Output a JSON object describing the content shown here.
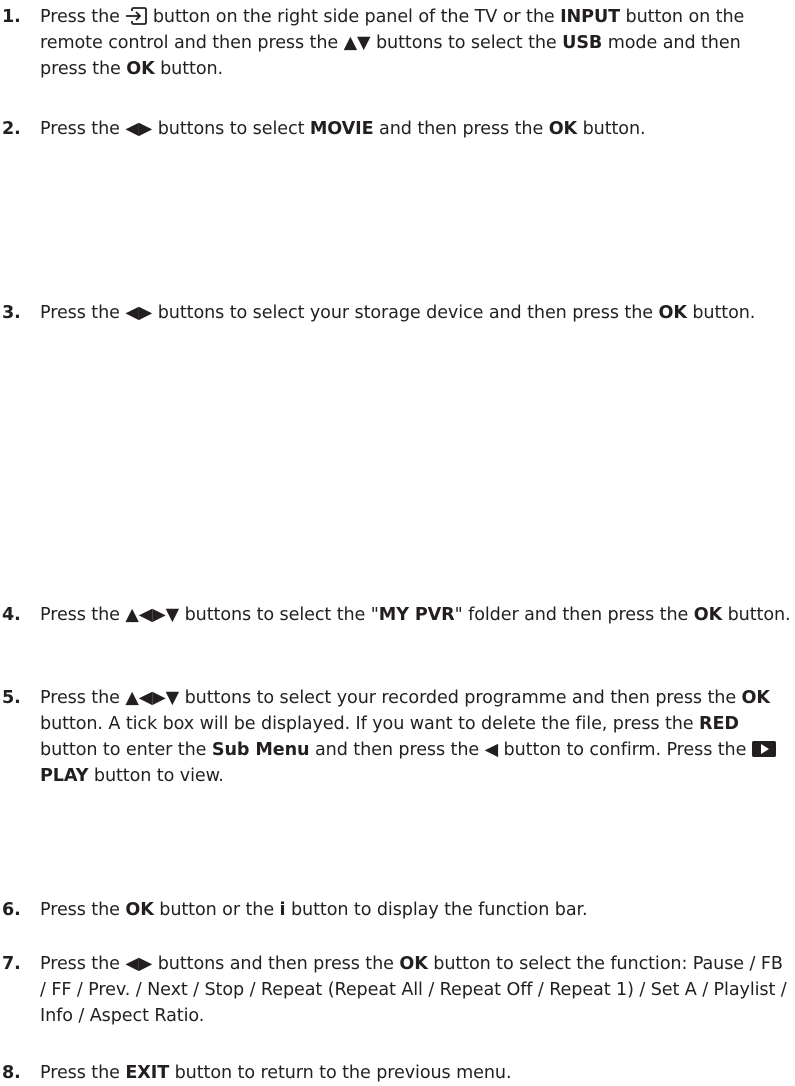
{
  "steps": [
    {
      "number": "1.",
      "segments": [
        "Press the",
        " button on the right side panel of the TV or the ",
        "INPUT",
        " button on the remote control and then press the ",
        "▲▼",
        " buttons to select the ",
        "USB",
        " mode and then press the ",
        "OK",
        " button."
      ]
    },
    {
      "number": "2.",
      "segments": [
        "Press the ",
        "◀▶",
        " buttons to select ",
        "MOVIE",
        " and then press the ",
        "OK",
        " button."
      ]
    },
    {
      "number": "3.",
      "segments": [
        "Press the ",
        "◀▶",
        " buttons to select your storage device and then press the ",
        "OK",
        " button."
      ]
    },
    {
      "number": "4.",
      "segments": [
        "Press the ",
        "▲◀▶▼",
        " buttons to select the \"",
        "MY PVR",
        "\" folder and then press the ",
        "OK",
        " button."
      ]
    },
    {
      "number": "5.",
      "segments": [
        "Press the ",
        "▲◀▶▼",
        " buttons to select your recorded programme and then press the ",
        "OK",
        " button. A tick box will be displayed. If you want to delete the file, press the ",
        "RED",
        " button to enter the ",
        "Sub Menu",
        " and then press the ",
        "◀",
        " button to confirm. Press the ",
        "PLAY",
        " button to view."
      ]
    },
    {
      "number": "6.",
      "segments": [
        "Press the ",
        "OK",
        " button or the ",
        "i",
        " button to display the function bar."
      ]
    },
    {
      "number": "7.",
      "segments": [
        "Press the ",
        "◀▶",
        " buttons and then press the ",
        "OK",
        " button to select the function: Pause / FB / FF / Prev. / Next / Stop / Repeat (Repeat All / Repeat Off / Repeat 1) / Set A / Playlist / Info / Aspect Ratio."
      ]
    },
    {
      "number": "8.",
      "segments": [
        "Press the ",
        "EXIT",
        " button to return to the previous menu."
      ]
    }
  ]
}
